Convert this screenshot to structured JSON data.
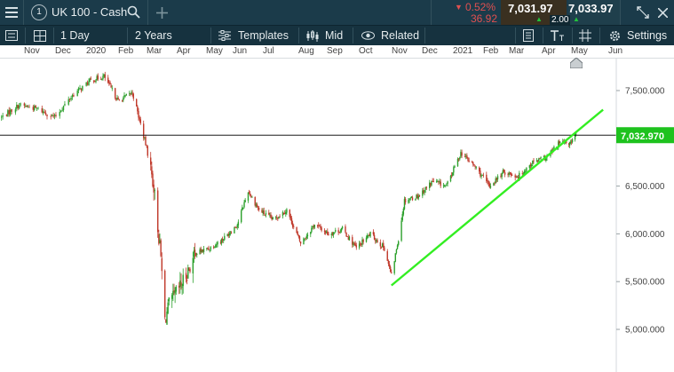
{
  "header": {
    "instrument_number": "1",
    "instrument_name": "UK 100 - Cash",
    "change_pct": "0.52%",
    "change_abs": "36.92",
    "sell_price": "7,031.97",
    "spread": "2.00",
    "buy_price": "7,033.97"
  },
  "toolbar": {
    "interval": "1 Day",
    "range": "2 Years",
    "templates": "Templates",
    "price_type": "Mid",
    "related": "Related",
    "settings": "Settings"
  },
  "colors": {
    "up": "#2ca02c",
    "down": "#c0392b",
    "trendline": "#33ee22",
    "price_tag": "#1ec21e",
    "header_bg": "#1b3b4a"
  },
  "chart_data": {
    "type": "candlestick",
    "x_tick_labels": [
      "Nov",
      "Dec",
      "2020",
      "Feb",
      "Mar",
      "Apr",
      "May",
      "Jun",
      "Jul",
      "Aug",
      "Sep",
      "Oct",
      "Nov",
      "Dec",
      "2021",
      "Feb",
      "Mar",
      "Apr",
      "May",
      "Jun"
    ],
    "y_tick_labels": [
      "7,500.000",
      "7,000.000",
      "6,500.000",
      "6,000.000",
      "5,500.000",
      "5,000.000"
    ],
    "ylim": [
      4700,
      7700
    ],
    "current_price_label": "7,032.970",
    "current_price": 7032.97,
    "trendline": {
      "start": {
        "date": "2020-10-30",
        "value": 5460
      },
      "end": {
        "date": "2021-06-04",
        "value": 7300
      }
    },
    "series_close": [
      [
        "2019-10-24",
        7220
      ],
      [
        "2019-11-07",
        7350
      ],
      [
        "2019-11-21",
        7310
      ],
      [
        "2019-12-05",
        7220
      ],
      [
        "2019-12-19",
        7450
      ],
      [
        "2020-01-02",
        7600
      ],
      [
        "2020-01-16",
        7650
      ],
      [
        "2020-01-30",
        7390
      ],
      [
        "2020-02-13",
        7480
      ],
      [
        "2020-02-27",
        6900
      ],
      [
        "2020-03-05",
        6500
      ],
      [
        "2020-03-12",
        5750
      ],
      [
        "2020-03-16",
        5100
      ],
      [
        "2020-03-20",
        5250
      ],
      [
        "2020-04-02",
        5480
      ],
      [
        "2020-04-16",
        5800
      ],
      [
        "2020-04-30",
        5850
      ],
      [
        "2020-05-14",
        5950
      ],
      [
        "2020-05-28",
        6100
      ],
      [
        "2020-06-08",
        6450
      ],
      [
        "2020-06-19",
        6250
      ],
      [
        "2020-07-03",
        6150
      ],
      [
        "2020-07-17",
        6250
      ],
      [
        "2020-07-31",
        5900
      ],
      [
        "2020-08-14",
        6100
      ],
      [
        "2020-08-28",
        6000
      ],
      [
        "2020-09-11",
        6050
      ],
      [
        "2020-09-25",
        5850
      ],
      [
        "2020-10-09",
        6000
      ],
      [
        "2020-10-23",
        5850
      ],
      [
        "2020-10-30",
        5560
      ],
      [
        "2020-11-06",
        5950
      ],
      [
        "2020-11-12",
        6350
      ],
      [
        "2020-11-26",
        6400
      ],
      [
        "2020-12-10",
        6550
      ],
      [
        "2020-12-24",
        6500
      ],
      [
        "2021-01-07",
        6850
      ],
      [
        "2021-01-21",
        6700
      ],
      [
        "2021-02-04",
        6500
      ],
      [
        "2021-02-18",
        6650
      ],
      [
        "2021-03-04",
        6600
      ],
      [
        "2021-03-18",
        6750
      ],
      [
        "2021-04-01",
        6800
      ],
      [
        "2021-04-15",
        6950
      ],
      [
        "2021-04-29",
        6950
      ],
      [
        "2021-05-06",
        7080
      ],
      [
        "2021-05-12",
        7030
      ]
    ]
  }
}
